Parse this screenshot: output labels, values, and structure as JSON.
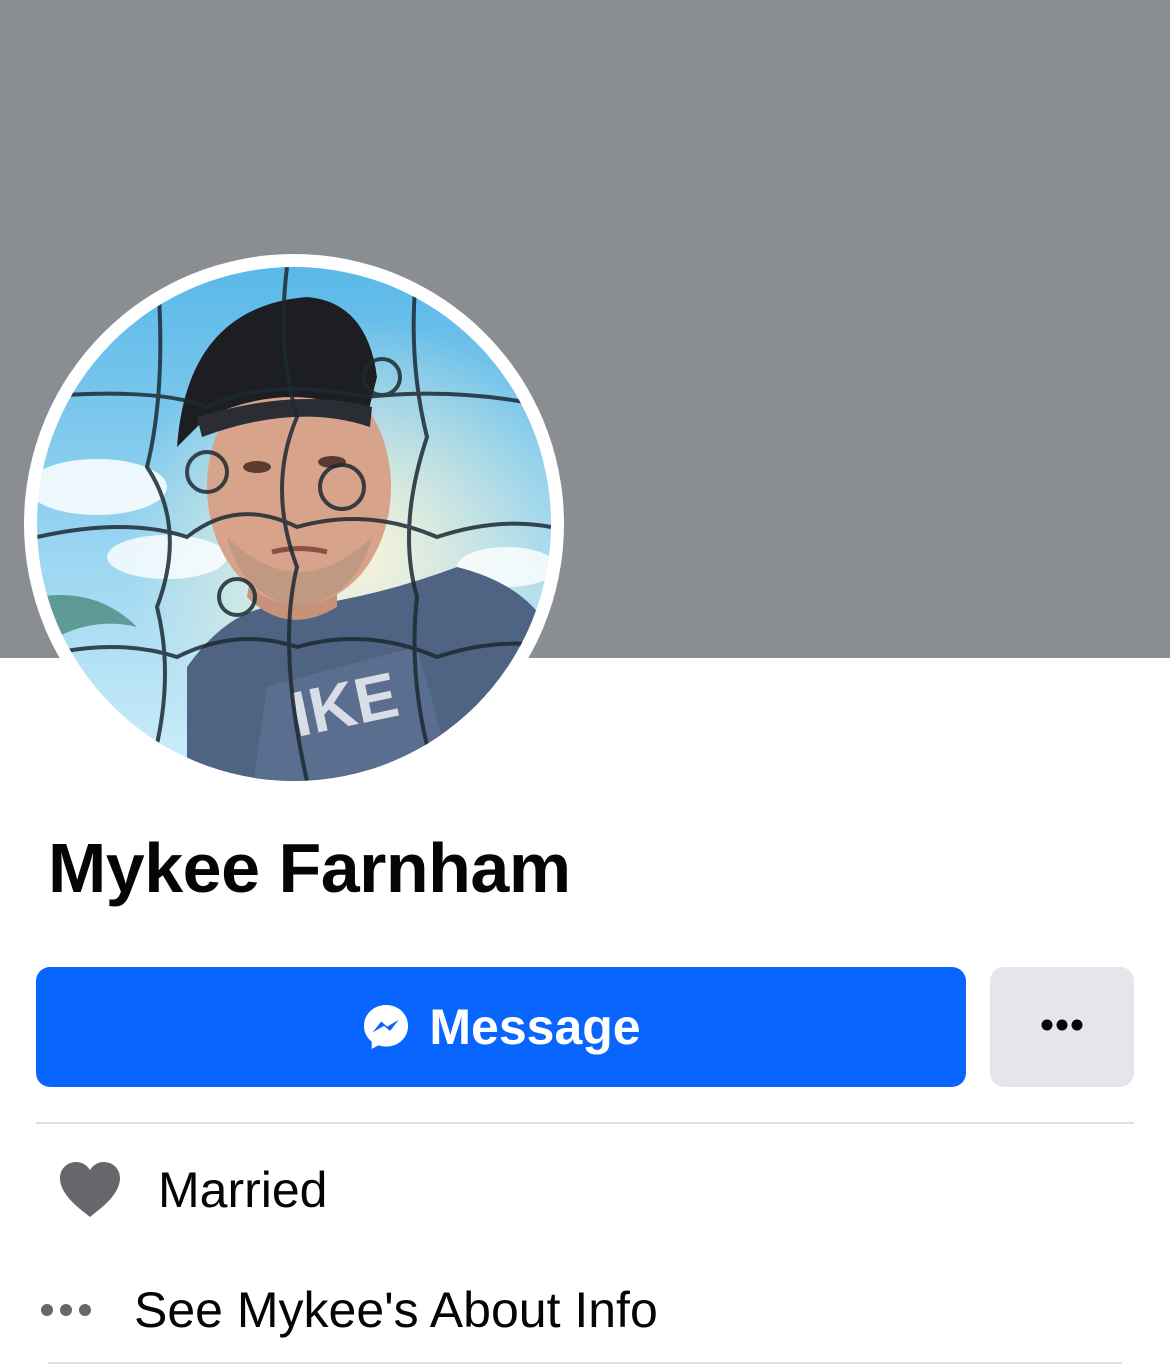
{
  "profile": {
    "name": "Mykee Farnham"
  },
  "actions": {
    "message_label": "Message",
    "message_icon": "messenger-icon",
    "more_icon": "more-dots-icon"
  },
  "details": {
    "relationship": "Married",
    "relationship_icon": "heart-icon",
    "about_link": "See Mykee's About Info",
    "about_icon": "more-dots-icon"
  },
  "colors": {
    "cover": "#8a8d91",
    "primary_button": "#0866ff",
    "secondary_button": "#e4e6eb",
    "icon_gray": "#65676b"
  }
}
